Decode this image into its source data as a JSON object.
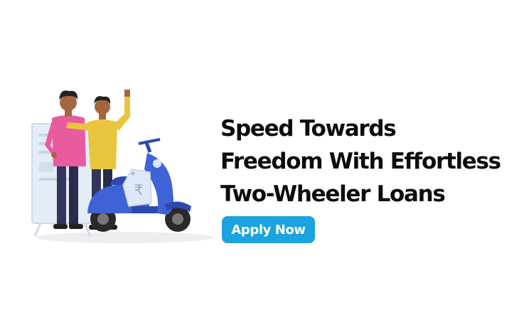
{
  "hero": {
    "headline": [
      "Speed Towards",
      "Freedom With Effortless",
      "Two-Wheeler Loans"
    ],
    "cta_label": "Apply Now",
    "price_tag_symbol": "₹"
  },
  "colors": {
    "accent": "#1aa3de",
    "scooter": "#3f63d6",
    "text": "#0d0d0d"
  },
  "icons": [
    "two-men-illustration",
    "scooter-icon",
    "rupee-tag-icon",
    "notice-board-icon"
  ]
}
